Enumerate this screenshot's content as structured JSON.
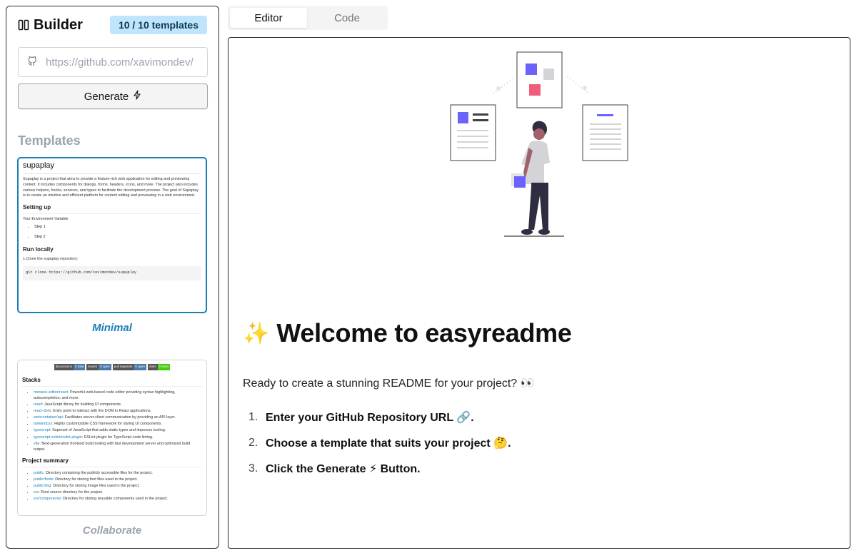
{
  "sidebar": {
    "title": "Builder",
    "template_count": "10 / 10 templates",
    "repo_input": {
      "placeholder": "https://github.com/xavimondev/"
    },
    "generate_label": "Generate",
    "templates_heading": "Templates",
    "templates": [
      {
        "name": "Minimal",
        "selected": true,
        "preview": {
          "title": "supaplay",
          "description": "Supaplay is a project that aims to provide a feature-rich web application for editing and previewing content. It includes components for dialogs, forms, headers, icons, and more. The project also includes various helpers, hooks, services, and types to facilitate the development process. The goal of Supaplay is to create an intuitive and efficient platform for content editing and previewing in a web environment.",
          "setup_heading": "Setting up",
          "env_heading": "Your Environment Variable",
          "env_steps": [
            "Step 1",
            "Step 2"
          ],
          "run_heading": "Run locally",
          "clone_text": "1.Clone the supaplay repository:",
          "clone_cmd": "git clone https://github.com/xavimondev/supaplay"
        }
      },
      {
        "name": "Collaborate",
        "selected": false,
        "preview": {
          "shields": [
            {
              "label": "discussions",
              "value": "0 total"
            },
            {
              "label": "issues",
              "value": "0 open"
            },
            {
              "label": "pull requests",
              "value": "0 open"
            },
            {
              "label": "stars",
              "value": "0 stars"
            }
          ],
          "stacks_heading": "Stacks",
          "stacks": [
            {
              "name": "monaco-editor/react",
              "desc": "Powerful web-based code editor providing syntax highlighting, autocompletion, and more."
            },
            {
              "name": "react",
              "desc": "JavaScript library for building UI components."
            },
            {
              "name": "react-dom",
              "desc": "Entry point to interact with the DOM in React applications."
            },
            {
              "name": "webcontainer/api",
              "desc": "Facilitates server-client communication by providing an API layer."
            },
            {
              "name": "tailwindcss",
              "desc": "Highly customizable CSS framework for styling UI components."
            },
            {
              "name": "typescript",
              "desc": "Superset of JavaScript that adds static types and improves tooling."
            },
            {
              "name": "typescript-eslint/eslint-plugin",
              "desc": "ESLint plugin for TypeScript code linting."
            },
            {
              "name": "vite",
              "desc": "Next-generation frontend build tooling with fast development server and optimized build output."
            }
          ],
          "summary_heading": "Project summary",
          "summary": [
            {
              "name": "public",
              "desc": "Directory containing the publicly accessible files for the project."
            },
            {
              "name": "public/fonts",
              "desc": "Directory for storing font files used in the project."
            },
            {
              "name": "public/img",
              "desc": "Directory for storing image files used in the project."
            },
            {
              "name": "src",
              "desc": "Root source directory for the project."
            },
            {
              "name": "src/components",
              "desc": "Directory for storing reusable components used in the project."
            }
          ]
        }
      }
    ]
  },
  "tabs": [
    {
      "label": "Editor",
      "active": true
    },
    {
      "label": "Code",
      "active": false
    }
  ],
  "main": {
    "welcome_emoji": "✨",
    "welcome_title": "Welcome to easyreadme",
    "intro": "Ready to create a stunning README for your project? 👀",
    "steps": [
      {
        "num": "1.",
        "text": "Enter your GitHub Repository URL 🔗."
      },
      {
        "num": "2.",
        "text": "Choose a template that suits your project 🤔."
      },
      {
        "num": "3.",
        "text": "Click the Generate ⚡ Button."
      }
    ]
  },
  "colors": {
    "accent": "#1a7fb5",
    "badge_bg": "#bfe4fb",
    "muted": "#9ca3af",
    "illustration_purple": "#6c63ff",
    "illustration_pink": "#f25c7c"
  }
}
